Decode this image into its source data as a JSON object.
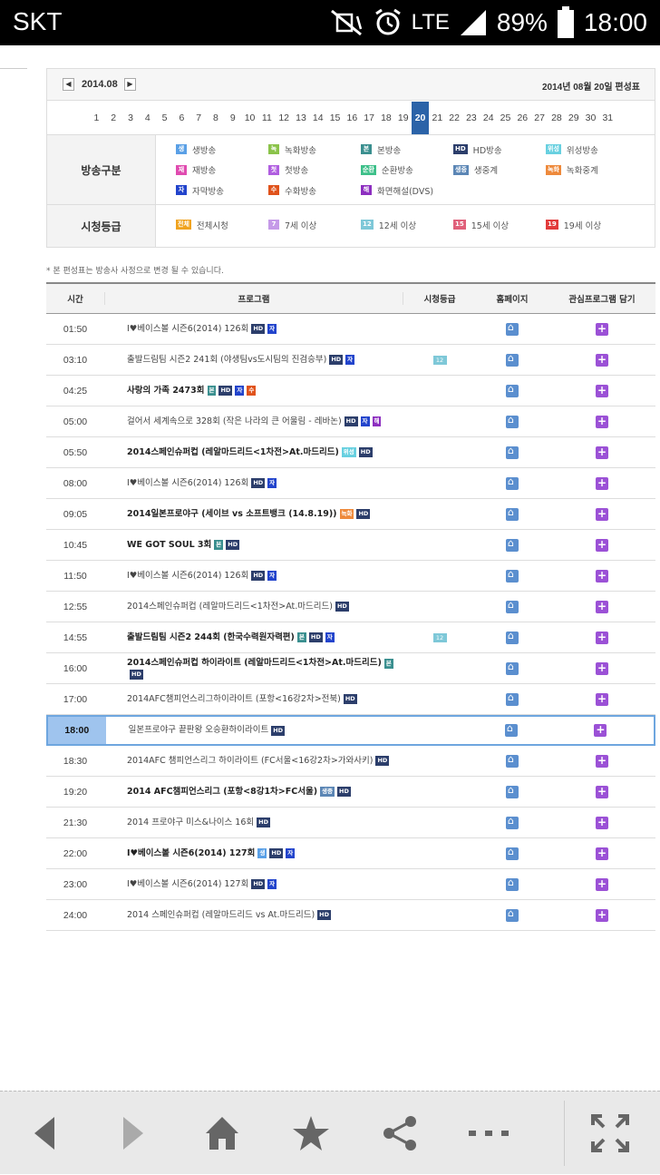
{
  "status": {
    "carrier": "SKT",
    "network": "LTE",
    "battery": "89%",
    "time": "18:00"
  },
  "schedule": {
    "month": "2014.08",
    "editorial": "2014년 08월 20일 편성표",
    "days": [
      "1",
      "2",
      "3",
      "4",
      "5",
      "6",
      "7",
      "8",
      "9",
      "10",
      "11",
      "12",
      "13",
      "14",
      "15",
      "16",
      "17",
      "18",
      "19",
      "20",
      "21",
      "22",
      "23",
      "24",
      "25",
      "26",
      "27",
      "28",
      "29",
      "30",
      "31"
    ],
    "selected_day": "20"
  },
  "legend": {
    "broadcast_head": "방송구분",
    "broadcast_items": [
      {
        "badge": "생",
        "label": "생방송",
        "color": "#5aa0e6"
      },
      {
        "badge": "녹",
        "label": "녹화방송",
        "color": "#8bc34a"
      },
      {
        "badge": "본",
        "label": "본방송",
        "color": "#3a8f8f"
      },
      {
        "badge": "HD",
        "label": "HD방송",
        "color": "#2c3e6b"
      },
      {
        "badge": "위성",
        "label": "위성방송",
        "color": "#68d0e0"
      },
      {
        "badge": "재",
        "label": "재방송",
        "color": "#e04bb0"
      },
      {
        "badge": "첫",
        "label": "첫방송",
        "color": "#b05ee0"
      },
      {
        "badge": "순환",
        "label": "순환방송",
        "color": "#3ec08a"
      },
      {
        "badge": "생중",
        "label": "생중계",
        "color": "#5b86b5"
      },
      {
        "badge": "녹화",
        "label": "녹화중계",
        "color": "#ee8a3c"
      },
      {
        "badge": "자",
        "label": "자막방송",
        "color": "#2244cc"
      },
      {
        "badge": "수",
        "label": "수화방송",
        "color": "#e0531c"
      },
      {
        "badge": "해",
        "label": "화면해설(DVS)",
        "color": "#8d2fc0"
      }
    ],
    "rating_head": "시청등급",
    "rating_items": [
      {
        "badge": "전체",
        "label": "전체시청",
        "color": "#f0a31e"
      },
      {
        "badge": "7",
        "label": "7세 이상",
        "color": "#c59ae8"
      },
      {
        "badge": "12",
        "label": "12세 이상",
        "color": "#7ec8d8"
      },
      {
        "badge": "15",
        "label": "15세 이상",
        "color": "#e0607a"
      },
      {
        "badge": "19",
        "label": "19세 이상",
        "color": "#e23b3b"
      }
    ]
  },
  "note": "* 본 편성표는 방송사 사정으로 변경 될 수 있습니다.",
  "table": {
    "headers": {
      "time": "시간",
      "program": "프로그램",
      "rating": "시청등급",
      "home": "홈페이지",
      "fav": "관심프로그램 담기"
    },
    "rows": [
      {
        "time": "01:50",
        "program": "I♥베이스볼 시즌6(2014) 126회",
        "bold": false,
        "badges": [
          "HD",
          "자"
        ],
        "rating": ""
      },
      {
        "time": "03:10",
        "program": "출발드림팀 시즌2 241회 (야생팀vs도시팀의 진검승부)",
        "bold": false,
        "badges": [
          "HD",
          "자"
        ],
        "rating": "12"
      },
      {
        "time": "04:25",
        "program": "사랑의 가족 2473회",
        "bold": true,
        "badges": [
          "본",
          "HD",
          "자",
          "수"
        ],
        "rating": ""
      },
      {
        "time": "05:00",
        "program": "걸어서 세계속으로 328회 (작은 나라의 큰 어울림 - 레바논)",
        "bold": false,
        "badges": [
          "HD",
          "자",
          "해"
        ],
        "rating": ""
      },
      {
        "time": "05:50",
        "program": "2014스페인슈퍼컵 (레알마드리드<1차전>At.마드리드)",
        "bold": true,
        "badges": [
          "위성",
          "HD"
        ],
        "rating": ""
      },
      {
        "time": "08:00",
        "program": "I♥베이스볼 시즌6(2014) 126회",
        "bold": false,
        "badges": [
          "HD",
          "자"
        ],
        "rating": ""
      },
      {
        "time": "09:05",
        "program": "2014일본프로야구 (세이브 vs 소프트뱅크 (14.8.19))",
        "bold": true,
        "badges": [
          "녹화",
          "HD"
        ],
        "rating": ""
      },
      {
        "time": "10:45",
        "program": "WE GOT SOUL 3회",
        "bold": true,
        "badges": [
          "본",
          "HD"
        ],
        "rating": ""
      },
      {
        "time": "11:50",
        "program": "I♥베이스볼 시즌6(2014) 126회",
        "bold": false,
        "badges": [
          "HD",
          "자"
        ],
        "rating": ""
      },
      {
        "time": "12:55",
        "program": "2014스페인슈퍼컵 (레알마드리드<1차전>At.마드리드)",
        "bold": false,
        "badges": [
          "HD"
        ],
        "rating": ""
      },
      {
        "time": "14:55",
        "program": "출발드림팀 시즌2 244회 (한국수력원자력편)",
        "bold": true,
        "badges": [
          "본",
          "HD",
          "자"
        ],
        "rating": "12"
      },
      {
        "time": "16:00",
        "program": "2014스페인슈퍼컵 하이라이트 (레알마드리드<1차전>At.마드리드)",
        "bold": true,
        "badges": [
          "본",
          "HD"
        ],
        "rating": ""
      },
      {
        "time": "17:00",
        "program": "2014AFC챔피언스리그하이라이트 (포항<16강2차>전북)",
        "bold": false,
        "badges": [
          "HD"
        ],
        "rating": ""
      },
      {
        "time": "18:00",
        "program": "일본프로야구 끝판왕 오승환하이라이트",
        "bold": false,
        "badges": [
          "HD"
        ],
        "rating": "",
        "now": true
      },
      {
        "time": "18:30",
        "program": "2014AFC 챔피언스리그 하이라이트 (FC서울<16강2차>가와사키)",
        "bold": false,
        "badges": [
          "HD"
        ],
        "rating": ""
      },
      {
        "time": "19:20",
        "program": "2014 AFC챔피언스리그 (포항<8강1차>FC서울)",
        "bold": true,
        "badges": [
          "생중",
          "HD"
        ],
        "rating": ""
      },
      {
        "time": "21:30",
        "program": "2014 프로야구 미스&나이스 16회",
        "bold": false,
        "badges": [
          "HD"
        ],
        "rating": ""
      },
      {
        "time": "22:00",
        "program": "I♥베이스볼 시즌6(2014) 127회",
        "bold": true,
        "badges": [
          "생",
          "HD",
          "자"
        ],
        "rating": ""
      },
      {
        "time": "23:00",
        "program": "I♥베이스볼 시즌6(2014) 127회",
        "bold": false,
        "badges": [
          "HD",
          "자"
        ],
        "rating": ""
      },
      {
        "time": "24:00",
        "program": "2014 스페인슈퍼컵 (레알마드리드 vs At.마드리드)",
        "bold": false,
        "badges": [
          "HD"
        ],
        "rating": ""
      }
    ]
  },
  "badge_colors": {
    "HD": "#2c3e6b",
    "자": "#2244cc",
    "본": "#3a8f8f",
    "수": "#e0531c",
    "해": "#8d2fc0",
    "위성": "#68d0e0",
    "녹화": "#ee8a3c",
    "생중": "#5b86b5",
    "생": "#5aa0e6"
  },
  "browser": {
    "icons": [
      "back-icon",
      "forward-icon",
      "home-icon",
      "bookmark-star-icon",
      "share-icon",
      "more-icon",
      "fullscreen-icon"
    ]
  }
}
